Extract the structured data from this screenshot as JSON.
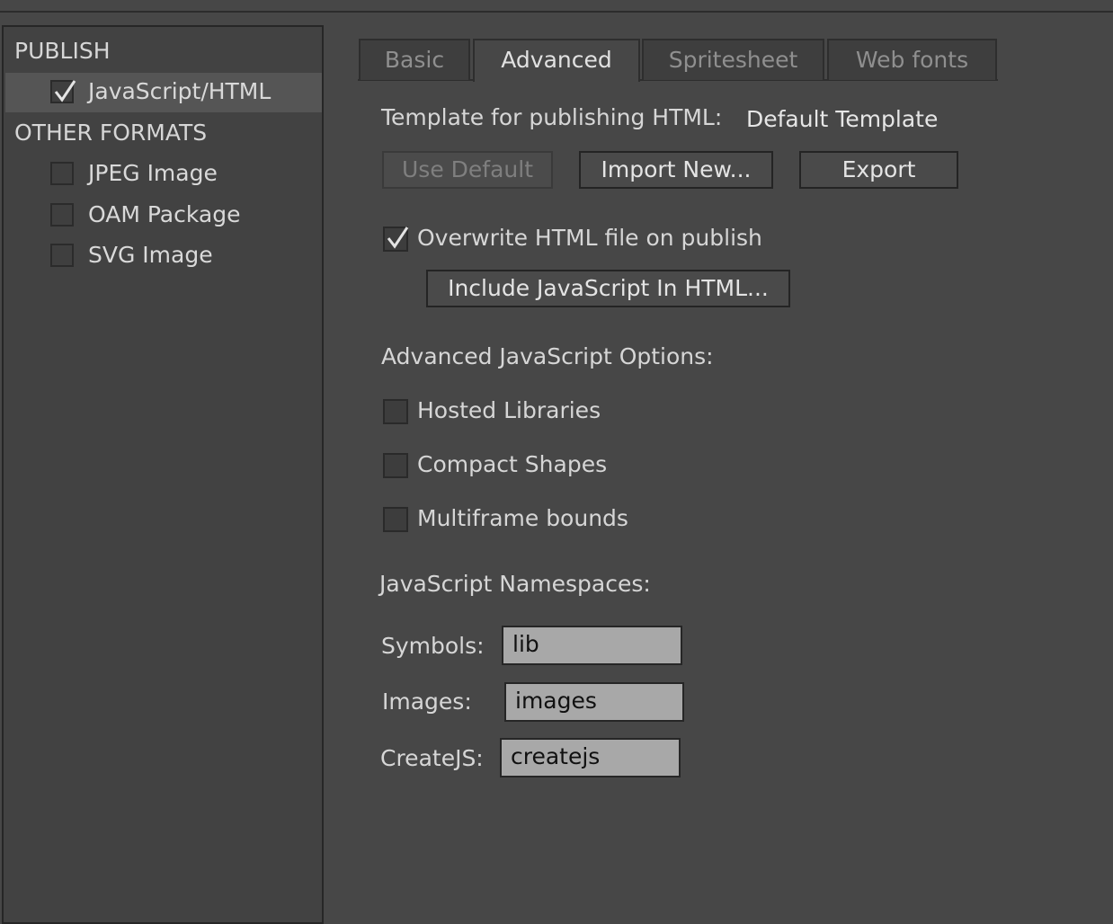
{
  "sidebar": {
    "publish_title": "PUBLISH",
    "publish_items": [
      {
        "label": "JavaScript/HTML",
        "checked": true
      }
    ],
    "other_title": "OTHER FORMATS",
    "other_items": [
      {
        "label": "JPEG Image",
        "checked": false
      },
      {
        "label": "OAM Package",
        "checked": false
      },
      {
        "label": "SVG Image",
        "checked": false
      }
    ]
  },
  "tabs": [
    {
      "label": "Basic",
      "active": false
    },
    {
      "label": "Advanced",
      "active": true
    },
    {
      "label": "Spritesheet",
      "active": false
    },
    {
      "label": "Web fonts",
      "active": false
    }
  ],
  "template": {
    "label": "Template for publishing HTML:",
    "value": "Default Template",
    "use_default": "Use Default",
    "import_new": "Import New...",
    "export": "Export"
  },
  "overwrite": {
    "label": "Overwrite HTML file on publish",
    "checked": true
  },
  "include_js_button": "Include JavaScript In HTML...",
  "advanced_js": {
    "title": "Advanced JavaScript Options:",
    "options": [
      {
        "label": "Hosted Libraries",
        "checked": false
      },
      {
        "label": "Compact Shapes",
        "checked": false
      },
      {
        "label": "Multiframe bounds",
        "checked": false
      }
    ]
  },
  "namespaces": {
    "title": "JavaScript Namespaces:",
    "symbols_label": "Symbols:",
    "symbols_value": "lib",
    "images_label": "Images:",
    "images_value": "images",
    "createjs_label": "CreateJS:",
    "createjs_value": "createjs"
  }
}
